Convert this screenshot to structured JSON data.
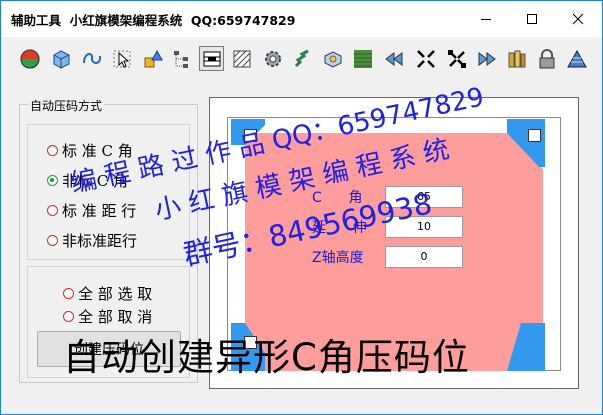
{
  "window": {
    "title": "辅助工具  小红旗模架编程系统  QQ:659747829"
  },
  "toolbar": {
    "buttons": [
      {
        "icon": "status-lights-icon"
      },
      {
        "icon": "cube-icon"
      },
      {
        "icon": "curve-icon"
      },
      {
        "icon": "select-arrow-icon"
      },
      {
        "icon": "shapes-icon"
      },
      {
        "icon": "tree-icon"
      },
      {
        "icon": "c-corner-icon",
        "pressed": true
      },
      {
        "icon": "hatch-icon"
      },
      {
        "icon": "gear-icon"
      },
      {
        "icon": "spring-icon"
      },
      {
        "icon": "block-icon"
      },
      {
        "icon": "grid-icon"
      },
      {
        "icon": "rewind-icon"
      },
      {
        "icon": "arrows-in-icon"
      },
      {
        "icon": "arrows-out-icon"
      },
      {
        "icon": "forward-icon"
      },
      {
        "icon": "books-icon"
      },
      {
        "icon": "lock-icon"
      },
      {
        "icon": "pyramid-icon"
      }
    ]
  },
  "pressure_mode": {
    "group_title": "自动压码方式",
    "options": [
      {
        "label": "标 准 C 角",
        "checked": false
      },
      {
        "label": "非标 C 角",
        "checked": true
      },
      {
        "label": "标 准 距 行",
        "checked": false
      },
      {
        "label": "非标准距行",
        "checked": false
      }
    ]
  },
  "selection": {
    "select_all": "全 部 选 取",
    "cancel_all": "全 部 取 消"
  },
  "create_button": "创建压码位",
  "params": {
    "angle_label": "C      角",
    "angle_value": "65",
    "extend_label": "延      伸",
    "extend_value": "10",
    "z_label": "Z轴高度",
    "z_value": "0"
  },
  "colors": {
    "plate": "#fd9e9c",
    "corner": "#3399ef",
    "watermark": "#2020e6"
  },
  "watermark": {
    "line1": "编 程 路 过 作 品 QQ：659747829",
    "line2": "小 红 旗 模 架 编 程 系 统",
    "line3": "群号：849569938"
  },
  "caption": "自动创建异形C角压码位"
}
